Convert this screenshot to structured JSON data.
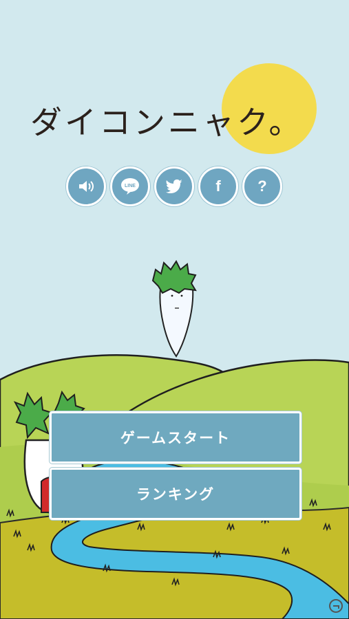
{
  "title": "ダイコンニャク。",
  "icons": [
    {
      "name": "sound-icon",
      "glyph": ""
    },
    {
      "name": "line-icon",
      "glyph": "LINE"
    },
    {
      "name": "twitter-icon",
      "glyph": ""
    },
    {
      "name": "facebook-icon",
      "glyph": "f"
    },
    {
      "name": "help-icon",
      "glyph": "?"
    }
  ],
  "buttons": {
    "start": "ゲームスタート",
    "ranking": "ランキング"
  },
  "colors": {
    "sky": "#d2e9ee",
    "sun": "#f3db4d",
    "button": "#6fa9bf",
    "hill_light": "#b8d456",
    "hill_dark": "#c5bd2a",
    "river": "#4bbde3",
    "leaf": "#4bab49"
  }
}
